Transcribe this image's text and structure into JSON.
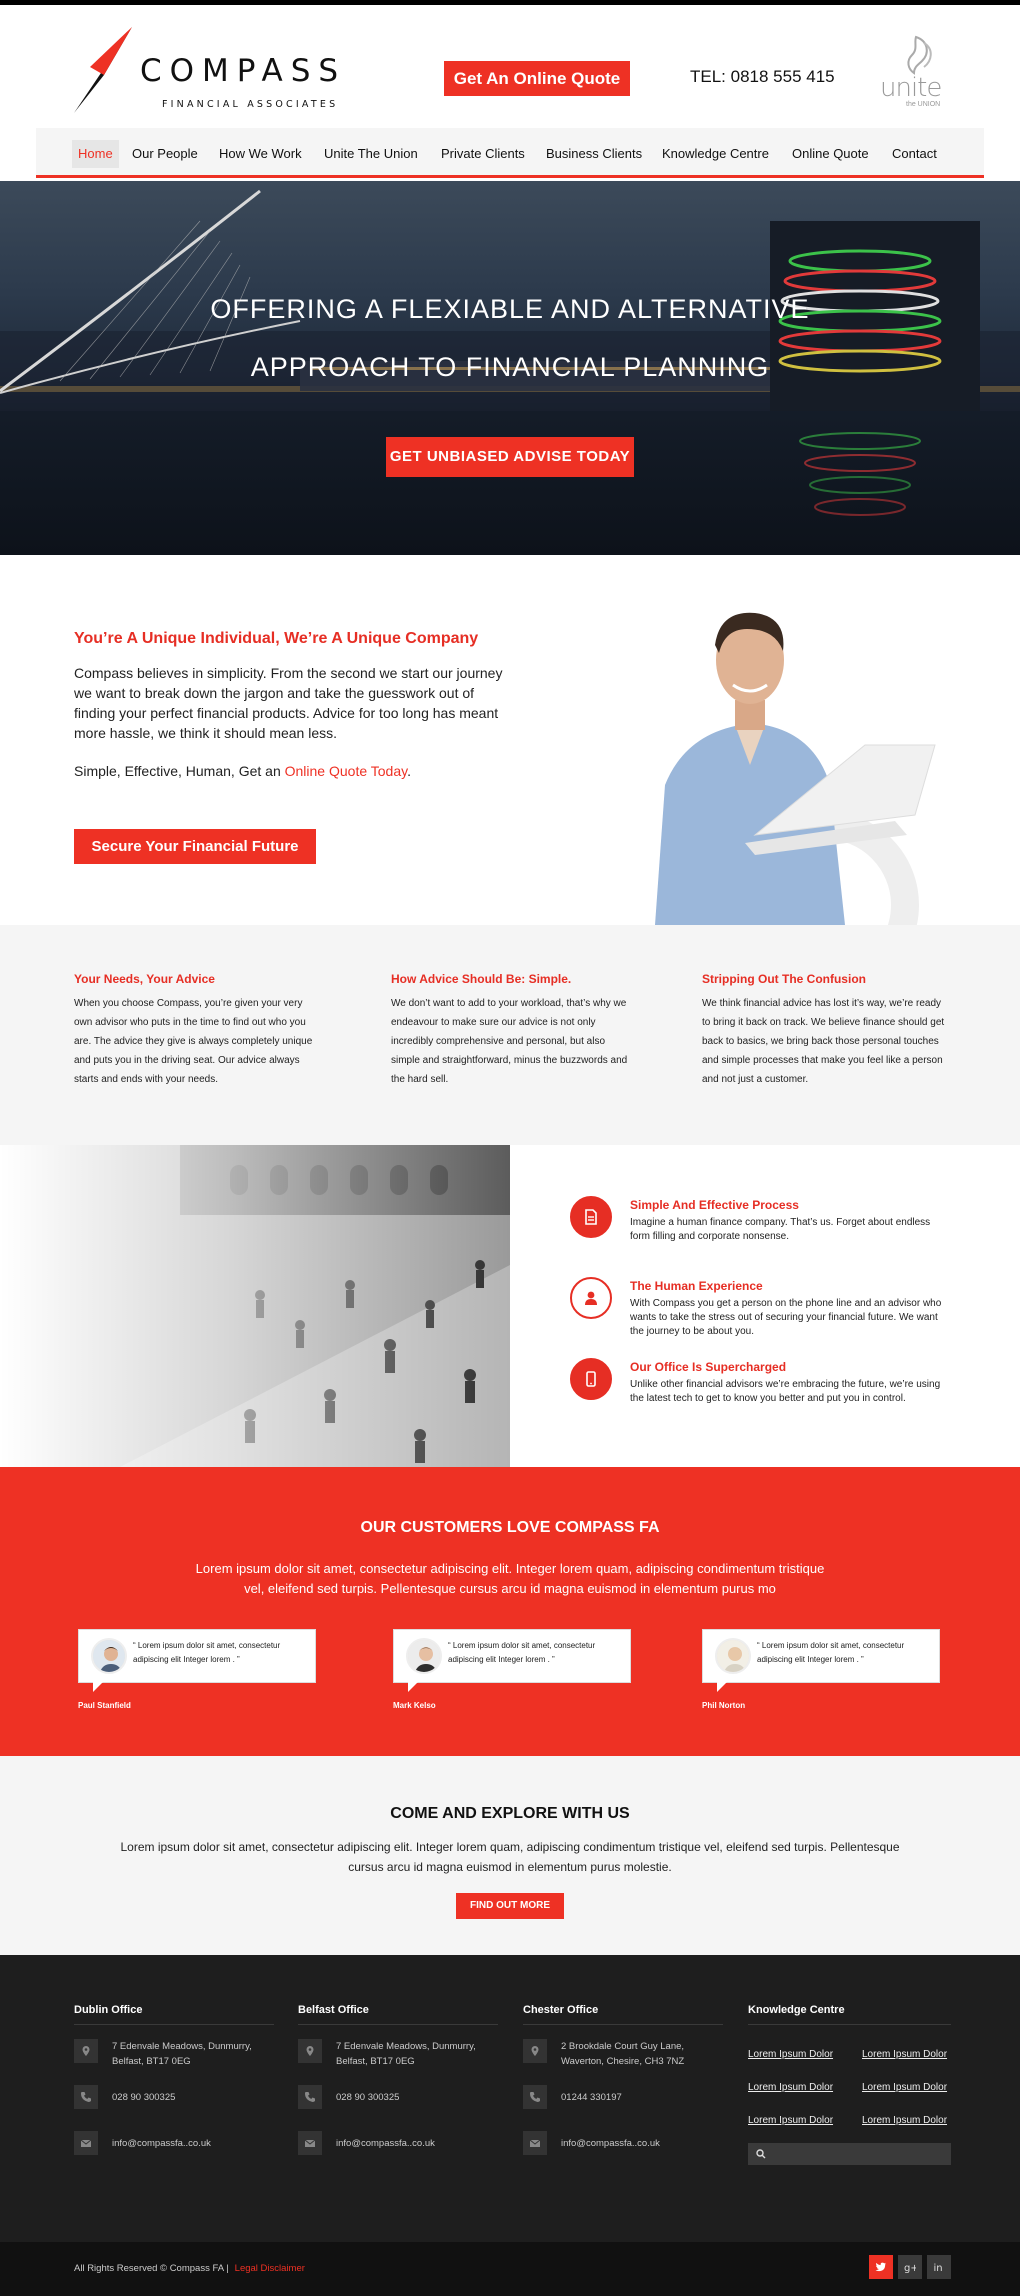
{
  "header": {
    "brand_name": "COMPASS",
    "brand_sub": "FINANCIAL ASSOCIATES",
    "quote_button": "Get An Online Quote",
    "tel": "TEL: 0818 555 415",
    "partner_logo": "unite",
    "partner_logo_tag": "the UNION"
  },
  "nav": {
    "items": [
      {
        "label": "Home",
        "active": true
      },
      {
        "label": "Our People"
      },
      {
        "label": "How We Work"
      },
      {
        "label": "Unite The Union"
      },
      {
        "label": "Private Clients"
      },
      {
        "label": "Business Clients"
      },
      {
        "label": "Knowledge Centre"
      },
      {
        "label": "Online Quote"
      },
      {
        "label": "Contact"
      }
    ]
  },
  "hero": {
    "title_line1": "OFFERING A FLEXIABLE AND ALTERNATIVE",
    "title_line2": "APPROACH TO FINANCIAL PLANNING",
    "button": "GET UNBIASED ADVISE TODAY"
  },
  "intro": {
    "heading": "You’re A Unique Individual, We’re A Unique Company",
    "paragraph": "Compass believes in simplicity. From the second we start our journey we want to break down the jargon and take the guesswork out of finding your perfect financial products. Advice for too long has meant more hassle, we think it should mean less.",
    "tagline_prefix": "Simple, Effective, Human, Get an ",
    "tagline_link": "Online Quote Today",
    "tagline_suffix": ".",
    "button": "Secure Your Financial Future"
  },
  "columns": [
    {
      "title": "Your Needs, Your Advice",
      "text": "When you choose Compass, you’re given your very own advisor who puts in the time to find out who you are. The advice they give is always completely unique and puts you in the driving seat. Our advice always starts and ends with your needs."
    },
    {
      "title": "How Advice Should Be: Simple.",
      "text": "We don’t want to add to your workload, that’s why we endeavour to make sure our advice is not only incredibly comprehensive and personal, but also simple and straightforward, minus the buzzwords and the hard sell."
    },
    {
      "title": "Stripping Out The Confusion",
      "text": "We think financial advice has lost it’s way, we’re ready to bring it back on track. We believe finance should get back to basics, we bring back those personal touches and simple processes that make you feel like a person and not just a customer."
    }
  ],
  "features": [
    {
      "title": "Simple And Effective Process",
      "text": "Imagine a human finance company. That’s us. Forget about endless form filling and corporate nonsense.",
      "icon": "document-icon"
    },
    {
      "title": "The Human Experience",
      "text": "With Compass you get a person on the phone line and an advisor who wants to take the stress out of securing your financial future. We want the journey to be about you.",
      "icon": "person-icon"
    },
    {
      "title": "Our Office Is Supercharged",
      "text": "Unlike other financial advisors we’re embracing the future, we’re using the latest tech to get to know you better and put you in control.",
      "icon": "mobile-icon"
    }
  ],
  "testimonials": {
    "heading": "OUR CUSTOMERS LOVE COMPASS FA",
    "text": "Lorem ipsum dolor sit amet, consectetur adipiscing elit. Integer lorem quam, adipiscing condimentum tristique vel, eleifend sed turpis. Pellentesque cursus arcu id magna euismod in elementum purus mo",
    "items": [
      {
        "quote": "“ Lorem ipsum dolor sit amet, consectetur adipiscing elit Integer lorem . ”",
        "name": "Paul Stanfield"
      },
      {
        "quote": "“ Lorem ipsum dolor sit amet, consectetur adipiscing elit Integer lorem . ”",
        "name": "Mark Kelso"
      },
      {
        "quote": "“ Lorem ipsum dolor sit amet, consectetur adipiscing elit Integer lorem . ”",
        "name": "Phil Norton"
      }
    ]
  },
  "explore": {
    "heading": "COME AND EXPLORE WITH US",
    "text": "Lorem ipsum dolor sit amet, consectetur adipiscing elit. Integer lorem quam, adipiscing condimentum tristique vel, eleifend sed turpis. Pellentesque cursus arcu id magna euismod in elementum purus molestie.",
    "button": "FIND OUT MORE"
  },
  "footer": {
    "offices": [
      {
        "title": "Dublin Office",
        "address": "7 Edenvale Meadows, Dunmurry, Belfast, BT17 0EG",
        "phone": "028 90 300325",
        "email": "info@compassfa..co.uk"
      },
      {
        "title": "Belfast Office",
        "address": "7 Edenvale Meadows, Dunmurry, Belfast, BT17 0EG",
        "phone": "028 90 300325",
        "email": "info@compassfa..co.uk"
      },
      {
        "title": "Chester Office",
        "address": "2 Brookdale Court Guy Lane, Waverton, Chesire, CH3 7NZ",
        "phone": "01244 330197",
        "email": "info@compassfa..co.uk"
      }
    ],
    "knowledge_title": "Knowledge Centre",
    "knowledge_links": [
      "Lorem Ipsum Dolor",
      "Lorem Ipsum Dolor",
      "Lorem Ipsum Dolor",
      "Lorem Ipsum Dolor",
      "Lorem Ipsum Dolor",
      "Lorem Ipsum Dolor"
    ],
    "search_placeholder": ""
  },
  "bottom": {
    "copyright": "All Rights Reserved © Compass FA  |",
    "disclaimer": "Legal Disclaimer",
    "social": [
      "twitter-icon",
      "google-plus-icon",
      "linkedin-icon"
    ]
  },
  "colors": {
    "accent": "#ee3124",
    "footer": "#1e1e1e",
    "bottom_bar": "#111111",
    "light_section": "#f5f5f5"
  }
}
